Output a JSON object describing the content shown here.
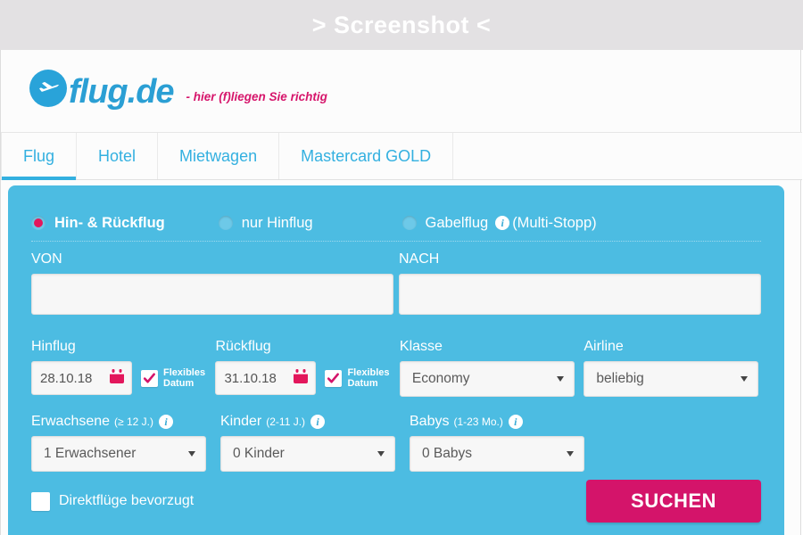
{
  "banner": {
    "text": "> Screenshot <"
  },
  "logo": {
    "word": "flug.de",
    "claim": "- hier (f)liegen Sie richtig",
    "mark": "airplane-icon"
  },
  "tabs": [
    {
      "label": "Flug",
      "active": true
    },
    {
      "label": "Hotel",
      "active": false
    },
    {
      "label": "Mietwagen",
      "active": false
    },
    {
      "label": "Mastercard GOLD",
      "active": false
    }
  ],
  "trip_type": {
    "options": [
      {
        "label": "Hin- & Rückflug",
        "selected": true
      },
      {
        "label": "nur Hinflug",
        "selected": false
      },
      {
        "label": "Gabelflug",
        "selected": false,
        "info": "i",
        "suffix": "(Multi-Stopp)"
      }
    ]
  },
  "route": {
    "from_label": "VON",
    "from_value": "",
    "to_label": "NACH",
    "to_value": ""
  },
  "dates": {
    "outbound_label": "Hinflug",
    "outbound_value": "28.10.18",
    "return_label": "Rückflug",
    "return_value": "31.10.18",
    "flex_label_line1": "Flexibles",
    "flex_label_line2": "Datum",
    "outbound_flex_checked": true,
    "return_flex_checked": true,
    "calendar_icon": "calendar-icon"
  },
  "options": {
    "class_label": "Klasse",
    "class_value": "Economy",
    "airline_label": "Airline",
    "airline_value": "beliebig"
  },
  "passengers": {
    "adults_label": "Erwachsene",
    "adults_hint": "(≥ 12 J.)",
    "adults_value": "1 Erwachsener",
    "children_label": "Kinder",
    "children_hint": "(2-11 J.)",
    "children_value": "0 Kinder",
    "babies_label": "Babys",
    "babies_hint": "(1-23 Mo.)",
    "babies_value": "0 Babys",
    "info_icon": "i"
  },
  "footer": {
    "direct_label": "Direktflüge bevorzugt",
    "direct_checked": false,
    "search_label": "SUCHEN"
  },
  "colors": {
    "panel_blue": "#4cbce2",
    "accent_pink": "#d4146a",
    "tab_blue": "#33b0e0",
    "banner_gray": "#e3e1e3"
  }
}
